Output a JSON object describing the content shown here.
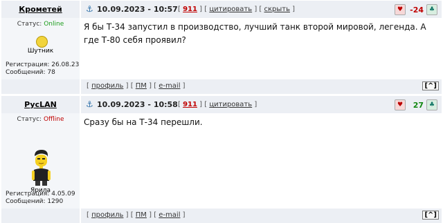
{
  "posts": [
    {
      "author": "Крометей",
      "status_label": "Статус: ",
      "status": "Online",
      "rank": "Шутник",
      "registration": "Регистрация: 26.08.23",
      "messages": "Сообщений: 78",
      "date": "10.09.2023 - 10:57",
      "post_number": "911",
      "cite": "цитировать",
      "hide": "скрыть",
      "score": "-24",
      "text": "Я бы Т-34 запустил в производство, лучший танк второй мировой, легенда. А где Т-80 себя проявил?",
      "footer": {
        "profile": "профиль",
        "pm": "ПМ",
        "email": "e-mail"
      }
    },
    {
      "author": "PycLAN",
      "status_label": "Статус: ",
      "status": "Offline",
      "rank": "Ярила",
      "registration": "Регистрация: 4.05.09",
      "messages": "Сообщений: 1290",
      "date": "10.09.2023 - 10:58",
      "post_number": "911",
      "cite": "цитировать",
      "score": "27",
      "text": "Сразу бы на Т-34 перешли.",
      "footer": {
        "profile": "профиль",
        "pm": "ПМ",
        "email": "e-mail"
      }
    }
  ],
  "to_top": "[^]",
  "icons": [
    "pin-icon",
    "vote-down-icon",
    "vote-up-icon",
    "smiley-icon",
    "avatar-image"
  ],
  "colors": {
    "online": "#1a9c1a",
    "offline": "#c00000",
    "negative": "#c00000",
    "positive": "#118811"
  }
}
